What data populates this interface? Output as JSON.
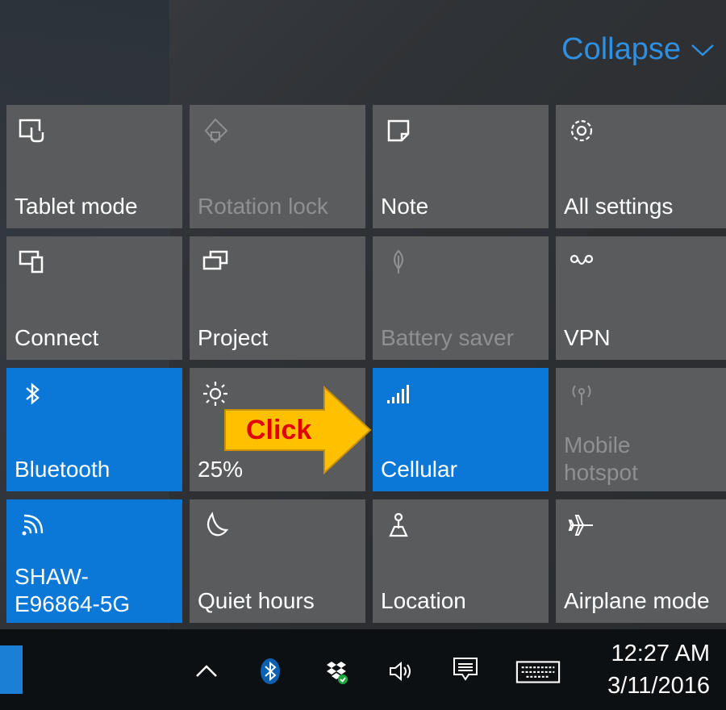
{
  "header": {
    "collapse_label": "Collapse"
  },
  "tiles": [
    {
      "label": "Tablet mode",
      "icon": "tablet-mode-icon",
      "state": "off"
    },
    {
      "label": "Rotation lock",
      "icon": "rotation-lock-icon",
      "state": "disabled"
    },
    {
      "label": "Note",
      "icon": "note-icon",
      "state": "off"
    },
    {
      "label": "All settings",
      "icon": "gear-icon",
      "state": "off"
    },
    {
      "label": "Connect",
      "icon": "connect-icon",
      "state": "off"
    },
    {
      "label": "Project",
      "icon": "project-icon",
      "state": "off"
    },
    {
      "label": "Battery saver",
      "icon": "battery-saver-icon",
      "state": "disabled"
    },
    {
      "label": "VPN",
      "icon": "vpn-icon",
      "state": "off"
    },
    {
      "label": "Bluetooth",
      "icon": "bluetooth-icon",
      "state": "on"
    },
    {
      "label": "25%",
      "icon": "brightness-icon",
      "state": "off"
    },
    {
      "label": "Cellular",
      "icon": "cellular-icon",
      "state": "on"
    },
    {
      "label_line1": "Mobile",
      "label_line2": "hotspot",
      "icon": "mobile-hotspot-icon",
      "state": "disabled"
    },
    {
      "label_line1": "SHAW-",
      "label_line2": "E96864-5G",
      "icon": "wifi-icon",
      "state": "on"
    },
    {
      "label": "Quiet hours",
      "icon": "moon-icon",
      "state": "off"
    },
    {
      "label": "Location",
      "icon": "location-icon",
      "state": "off"
    },
    {
      "label": "Airplane mode",
      "icon": "airplane-icon",
      "state": "off"
    }
  ],
  "callout": {
    "text": "Click"
  },
  "taskbar": {
    "icons": [
      "chevron-up-icon",
      "bluetooth-icon",
      "dropbox-icon",
      "volume-icon",
      "action-center-icon",
      "keyboard-icon"
    ],
    "time": "12:27 AM",
    "date": "3/11/2016"
  },
  "colors": {
    "accent": "#0b78d7",
    "tile": "#5a5b5c",
    "collapse": "#2f8fe0",
    "callout_fill": "#ffc000",
    "callout_text": "#e00000"
  }
}
